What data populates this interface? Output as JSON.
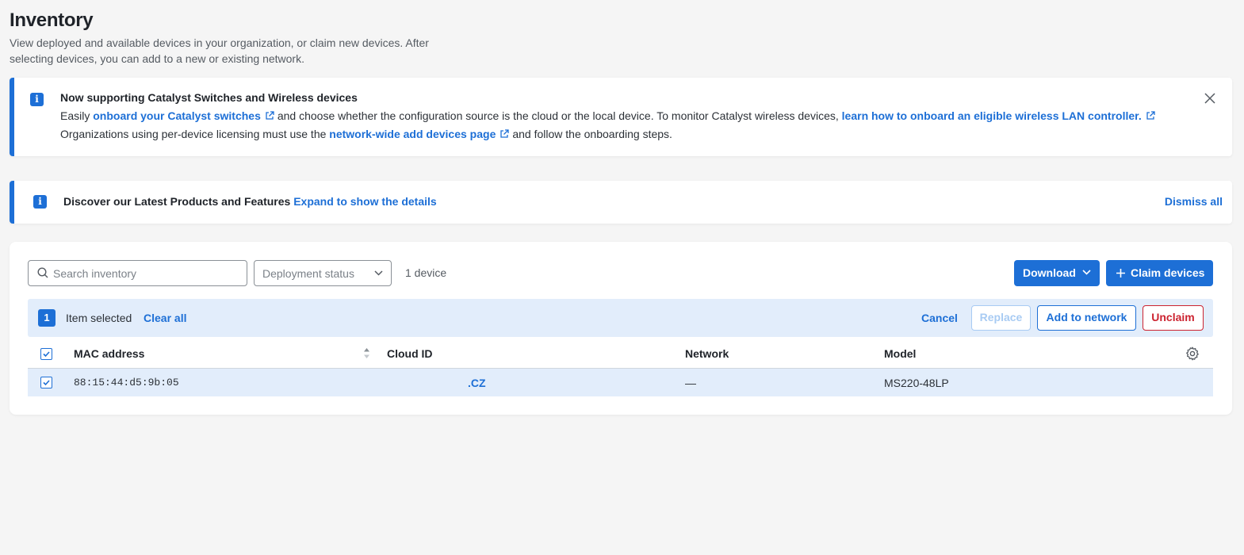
{
  "page": {
    "title": "Inventory",
    "description": "View deployed and available devices in your organization, or claim new devices. After selecting devices, you can add to a new or existing network."
  },
  "banner_catalyst": {
    "title": "Now supporting Catalyst Switches and Wireless devices",
    "line1_part1": "Easily",
    "line1_link1": "onboard your Catalyst switches",
    "line1_part2": "and choose whether the configuration source is the cloud or the local device. To monitor Catalyst wireless devices,",
    "line1_link2": "learn how to onboard an eligible wireless LAN controller.",
    "line2_part1": "Organizations using per-device licensing must use the",
    "line2_link": "network-wide add devices page",
    "line2_part2": "and follow the onboarding steps."
  },
  "banner_products": {
    "title": "Discover our Latest Products and Features",
    "expand_link": "Expand to show the details",
    "dismiss_all": "Dismiss all"
  },
  "toolbar": {
    "search_placeholder": "Search inventory",
    "deployment_status": "Deployment status",
    "device_count": "1 device",
    "download_label": "Download",
    "claim_label": "Claim devices"
  },
  "selection_bar": {
    "count": "1",
    "text": "Item selected",
    "clear_all": "Clear all",
    "cancel": "Cancel",
    "replace": "Replace",
    "add_to_network": "Add to network",
    "unclaim": "Unclaim"
  },
  "table": {
    "columns": [
      "MAC address",
      "Cloud ID",
      "Network",
      "Model"
    ],
    "rows": [
      {
        "mac": "88:15:44:d5:9b:05",
        "cloud_id": ".CZ",
        "network": "—",
        "model": "MS220-48LP",
        "checked": true
      }
    ]
  },
  "colors": {
    "accent": "#1d6fd6",
    "danger": "#cc2330",
    "selection_bg": "#e2edfb"
  }
}
